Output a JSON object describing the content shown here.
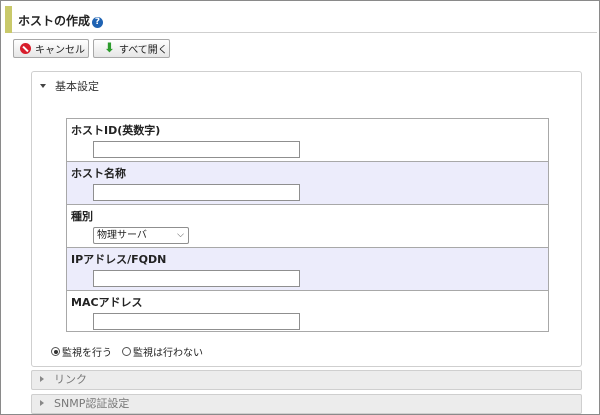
{
  "header": {
    "title": "ホストの作成"
  },
  "toolbar": {
    "cancel_label": "キャンセル",
    "expand_all_label": "すべて開く"
  },
  "basic_settings": {
    "label": "基本設定",
    "fields": [
      {
        "label": "ホストID(英数字)",
        "type": "text",
        "value": ""
      },
      {
        "label": "ホスト名称",
        "type": "text",
        "value": ""
      },
      {
        "label": "種別",
        "type": "select",
        "value": "物理サーバ"
      },
      {
        "label": "IPアドレス/FQDN",
        "type": "text",
        "value": ""
      },
      {
        "label": "MACアドレス",
        "type": "text",
        "value": ""
      }
    ],
    "monitoring": {
      "options": [
        "監視を行う",
        "監視は行わない"
      ],
      "selected": "監視を行う"
    }
  },
  "sections": [
    {
      "label": "リンク"
    },
    {
      "label": "SNMP認証設定"
    }
  ]
}
